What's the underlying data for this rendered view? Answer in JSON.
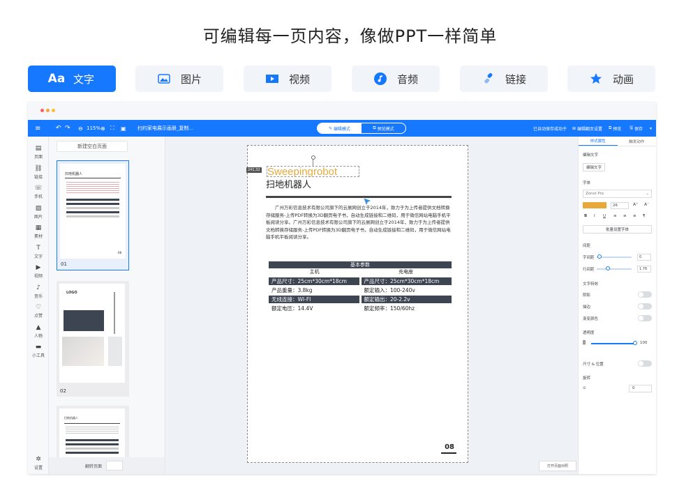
{
  "headline": "可编辑每一页内容，像做PPT一样简单",
  "feature_tabs": [
    {
      "icon": "aa-text-icon",
      "glyph": "Aa",
      "label": "文字",
      "active": true
    },
    {
      "icon": "image-icon",
      "glyph": "",
      "label": "图片",
      "active": false
    },
    {
      "icon": "video-icon",
      "glyph": "",
      "label": "视频",
      "active": false
    },
    {
      "icon": "audio-icon",
      "glyph": "",
      "label": "音频",
      "active": false
    },
    {
      "icon": "link-icon",
      "glyph": "",
      "label": "链接",
      "active": false
    },
    {
      "icon": "star-icon",
      "glyph": "",
      "label": "动画",
      "active": false
    }
  ],
  "colors": {
    "accent": "#1677ff",
    "dark_table": "#3d4452",
    "gold": "#e8a93a",
    "dot_red": "#ff5f57",
    "dot_yellow": "#febc2e",
    "dot_orange": "#f7a440"
  },
  "toolbar": {
    "zoom": "115%",
    "doc_title": "扫约家电展示画册_复制...",
    "mode_edit": "编辑模式",
    "mode_preview": "预览模式",
    "autosave": "已自动保存成功于",
    "page_manage": "编辑翻页设置",
    "preview": "预览",
    "save": "保存"
  },
  "leftbar": [
    {
      "icon": "doc-icon",
      "label": "页面"
    },
    {
      "icon": "link-icon",
      "label": "链接"
    },
    {
      "icon": "phone-icon",
      "label": "手机"
    },
    {
      "icon": "image-icon",
      "label": "图片"
    },
    {
      "icon": "grid-icon",
      "label": "素材"
    },
    {
      "icon": "text-icon",
      "label": "文字"
    },
    {
      "icon": "video-icon",
      "label": "视频"
    },
    {
      "icon": "music-icon",
      "label": "音乐"
    },
    {
      "icon": "heart-icon",
      "label": "点赞"
    },
    {
      "icon": "person-icon",
      "label": "人物"
    },
    {
      "icon": "toolbox-icon",
      "label": "小工具"
    },
    {
      "icon": "settings-icon",
      "label": "设置"
    }
  ],
  "thumbs": {
    "new_page": "新建空白页面",
    "pages": [
      {
        "num": "01",
        "title": "扫地机器人"
      },
      {
        "num": "02",
        "title": "LOGO"
      },
      {
        "num": "",
        "title": "扫地机器人"
      }
    ],
    "footer": "翻转页面"
  },
  "page": {
    "size_tag": "241,32",
    "title_en": "Sweepingrobot",
    "title_cn": "扫地机器人",
    "paragraph": "广州万彩信息技术有限公司旗下的云展网创立于2014年，致力于为上传者提供文档转换存储服务-上传PDF转换为3D翻页电子书，自动生成链接和二维码，用于微信网站电脑手机平板阅读分享。广州万彩信息技术有限公司旗下的云展网创立于2014年，致力于为上传者提供文档转换存储服务-上传PDF转换为3D翻页电子书，自动生成链接和二维码，用于微信网站电脑手机平板阅读分享。",
    "table_title": "基本参数",
    "col_left": "主机",
    "col_right": "充电座",
    "rows": [
      {
        "l": "产品尺寸：25cm*30cm*18cm",
        "r": "产品尺寸：25cm*30cm*18cm",
        "dark": true
      },
      {
        "l": "产品重量：3.8kg",
        "r": "额定输入：100-240v",
        "dark": false
      },
      {
        "l": "无线连接：WI-FI",
        "r": "额定输出：20-2.2v",
        "dark": true
      },
      {
        "l": "额定电压：14.4V",
        "r": "额定频率：150/60hz",
        "dark": false
      }
    ],
    "page_num": "08"
  },
  "canvas_btn": "打开页面对照",
  "right_panel": {
    "tab_style": "样式属性",
    "tab_anim": "触发动作",
    "section_edit": "编辑文字",
    "edit_btn": "编辑文字",
    "section_font": "字体",
    "font_name": "Zonst Pro",
    "font_size": "26",
    "bold": "B",
    "italic": "I",
    "underline": "U",
    "batch_btn": "批量设置字体",
    "section_spacing": "间距",
    "letter_spacing_label": "字间距",
    "letter_spacing_val": "0",
    "line_spacing_label": "行间距",
    "line_spacing_val": "1.76",
    "section_effects": "文字特效",
    "shadow": "阴影",
    "stroke": "描边",
    "gradient": "渐变颜色",
    "section_opacity": "透明度",
    "opacity_val": "100",
    "size_pos": "尺寸 & 位置",
    "rotate": "旋转",
    "rotate_val": "0"
  }
}
